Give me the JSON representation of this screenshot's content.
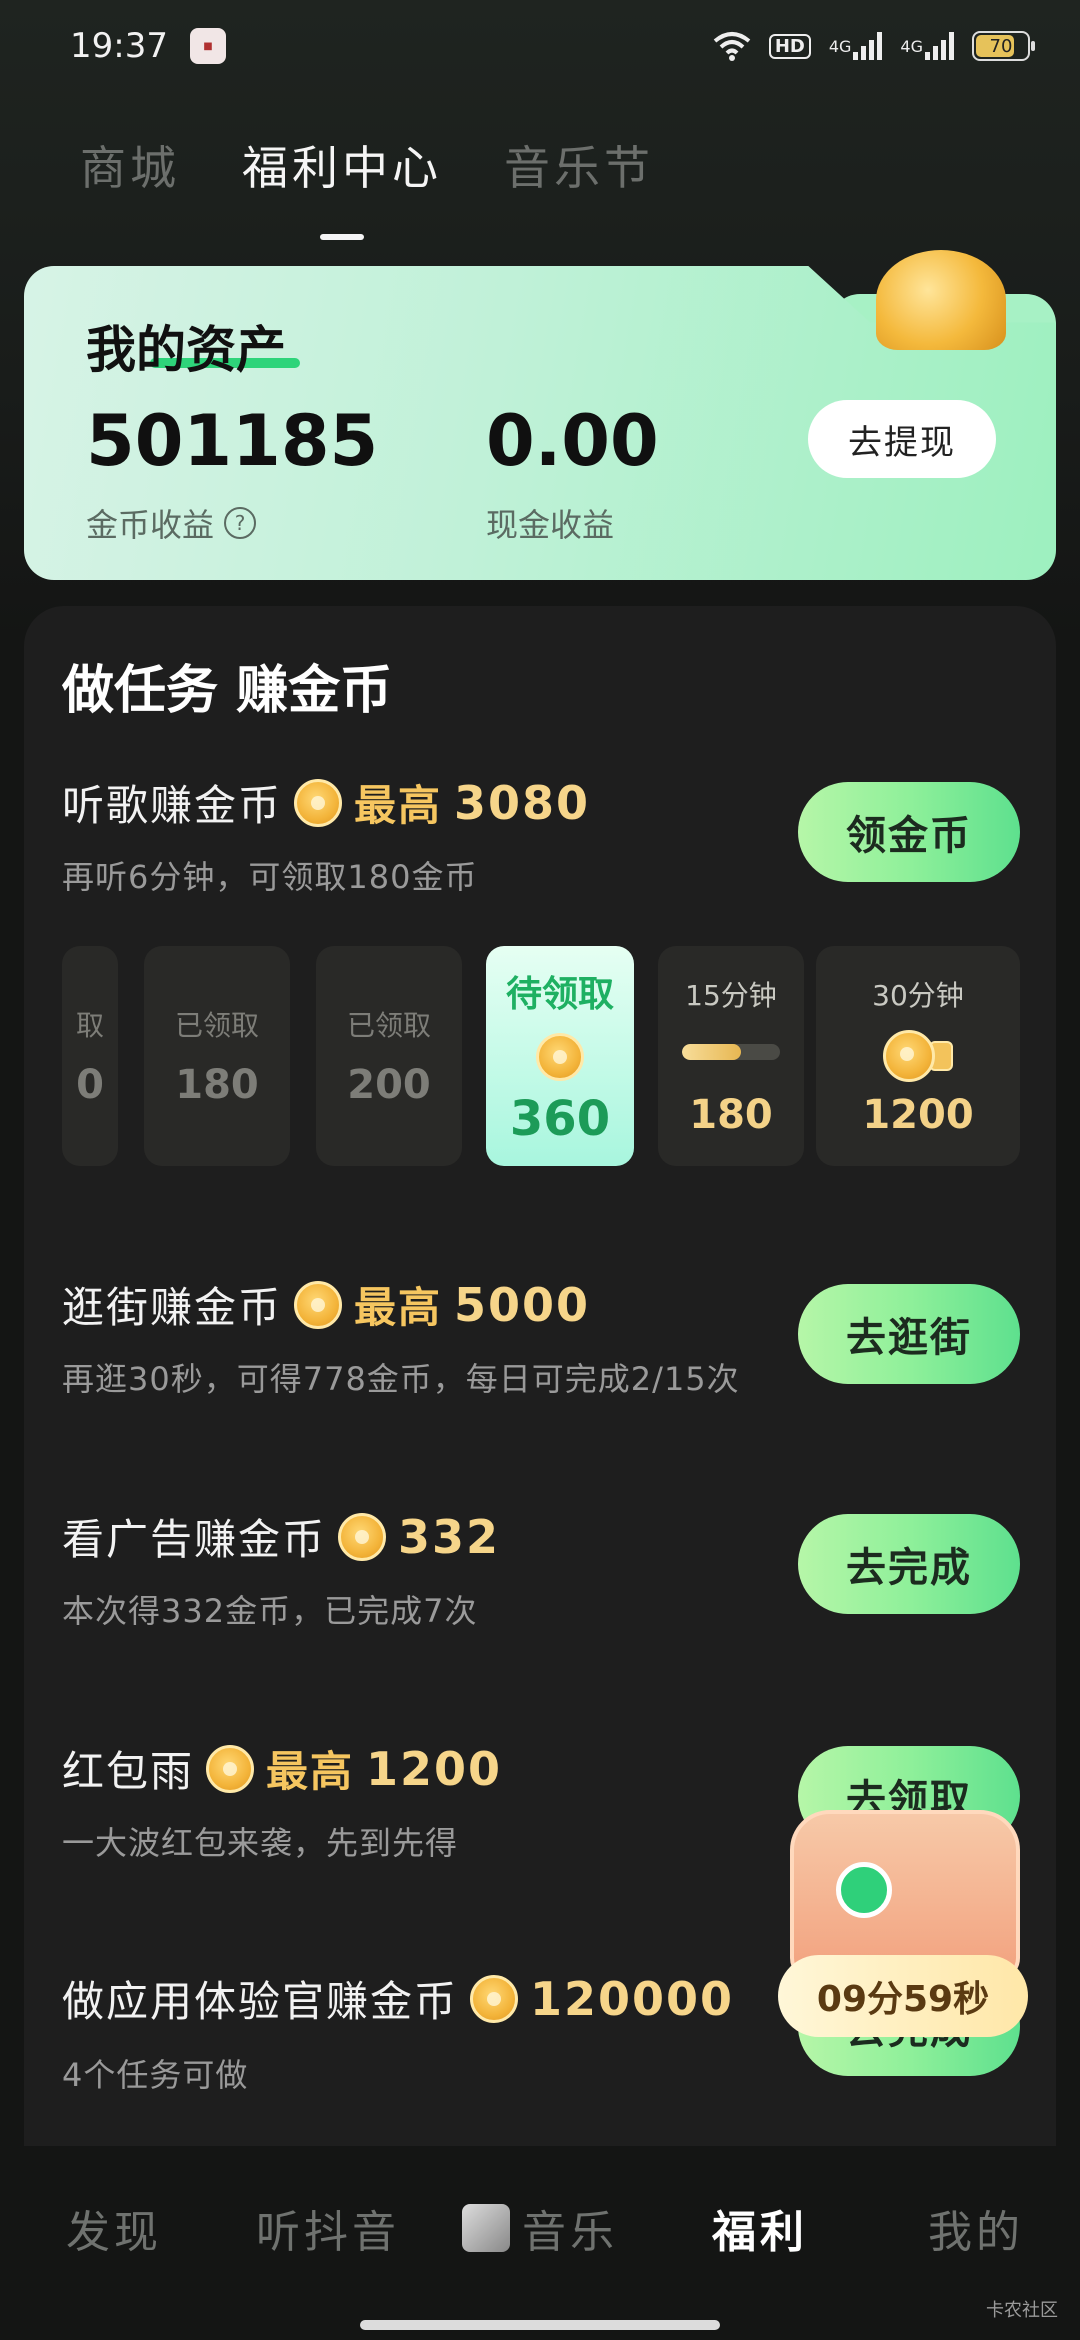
{
  "status_bar": {
    "time": "19:37",
    "app_icon": "news-app-icon",
    "wifi_icon": "wifi-icon",
    "hd_label": "HD",
    "network_1": "4G",
    "network_2": "4G",
    "battery": "70"
  },
  "top_tabs": [
    {
      "label": "商城",
      "active": false
    },
    {
      "label": "福利中心",
      "active": true
    },
    {
      "label": "音乐节",
      "active": false
    }
  ],
  "assets": {
    "title": "我的资产",
    "coin_value": "501185",
    "coin_label": "金币收益",
    "help_symbol": "?",
    "cash_value": "0.00",
    "cash_label": "现金收益",
    "withdraw_button": "去提现"
  },
  "tasks_title": "做任务 赚金币",
  "tasks": [
    {
      "title": "听歌赚金币",
      "prefix": "最高",
      "amount": "3080",
      "subtitle": "再听6分钟，可领取180金币",
      "button": "领金币"
    },
    {
      "title": "逛街赚金币",
      "prefix": "最高",
      "amount": "5000",
      "subtitle": "再逛30秒，可得778金币，每日可完成2/15次",
      "button": "去逛街"
    },
    {
      "title": "看广告赚金币",
      "prefix": "",
      "amount": "332",
      "subtitle": "本次得332金币，已完成7次",
      "button": "去完成"
    },
    {
      "title": "红包雨",
      "prefix": "最高",
      "amount": "1200",
      "subtitle": "一大波红包来袭，先到先得",
      "button": "去领取"
    },
    {
      "title": "做应用体验官赚金币",
      "prefix": "",
      "amount": "120000",
      "subtitle": "4个任务可做",
      "button": "去完成"
    }
  ],
  "reward_tiles": [
    {
      "top": "取",
      "value": "0",
      "state": "claimed"
    },
    {
      "top": "已领取",
      "value": "180",
      "state": "claimed"
    },
    {
      "top": "已领取",
      "value": "200",
      "state": "claimed"
    },
    {
      "top": "待领取",
      "value": "360",
      "state": "pending"
    },
    {
      "top": "15分钟",
      "value": "180",
      "state": "upcoming",
      "progress": 0.6
    },
    {
      "top": "30分钟",
      "value": "1200",
      "state": "upcoming"
    }
  ],
  "chest_timer": "09分59秒",
  "bottom_nav": [
    {
      "label": "发现",
      "active": false
    },
    {
      "label": "听抖音",
      "active": false
    },
    {
      "label": "音乐",
      "active": false
    },
    {
      "label": "福利",
      "active": true
    },
    {
      "label": "我的",
      "active": false
    }
  ],
  "watermark": "卡农社区"
}
